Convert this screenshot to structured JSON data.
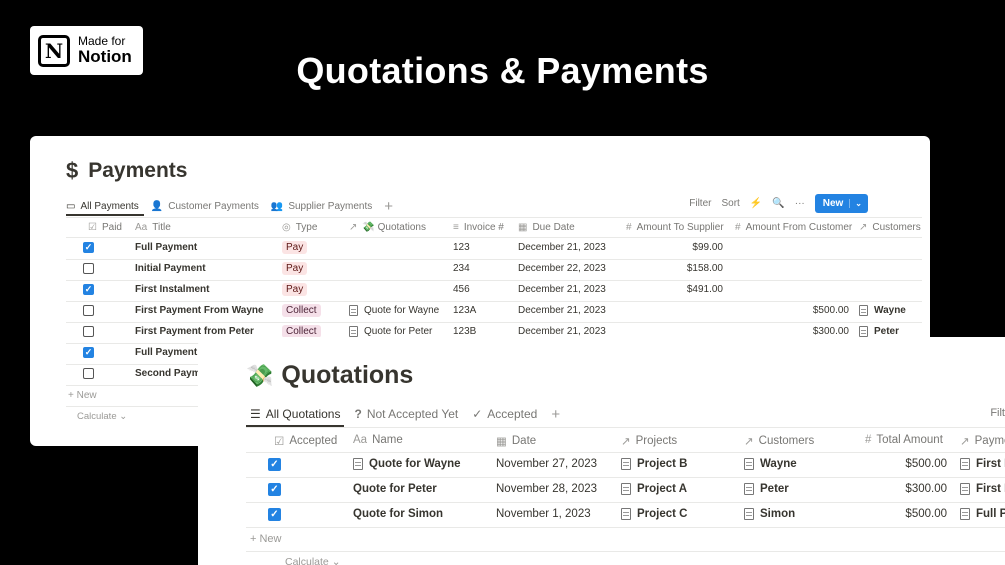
{
  "badge": {
    "line1": "Made for",
    "line2": "Notion",
    "logo": "N"
  },
  "hero_title": "Quotations & Payments",
  "payments": {
    "title_icon": "$",
    "title": "Payments",
    "tabs": [
      {
        "icon": "table-icon",
        "glyph": "▭",
        "label": "All Payments"
      },
      {
        "icon": "person-icon",
        "glyph": "👤",
        "label": "Customer Payments"
      },
      {
        "icon": "people-icon",
        "glyph": "👥",
        "label": "Supplier Payments"
      }
    ],
    "add_tab": "+",
    "toolbar": {
      "filter": "Filter",
      "sort": "Sort",
      "lightning": "⚡",
      "search": "🔍",
      "more": "···",
      "new": "New",
      "new_chevron": "⌄"
    },
    "headers": [
      {
        "icon": "☑",
        "label": "Paid"
      },
      {
        "icon": "Aa",
        "label": "Title"
      },
      {
        "icon": "◎",
        "label": "Type"
      },
      {
        "icon": "↗",
        "label": "💸 Quotations"
      },
      {
        "icon": "≡",
        "label": "Invoice #"
      },
      {
        "icon": "▦",
        "label": "Due Date"
      },
      {
        "icon": "#",
        "label": "Amount To Supplier"
      },
      {
        "icon": "#",
        "label": "Amount From Customer"
      },
      {
        "icon": "↗",
        "label": "Customers"
      }
    ],
    "rows": [
      {
        "paid": true,
        "title": "Full Payment",
        "type": "Pay",
        "quotation": "",
        "invoice": "123",
        "due": "December 21, 2023",
        "to_supplier": "$99.00",
        "from_customer": "",
        "customer": ""
      },
      {
        "paid": false,
        "title": "Initial Payment",
        "type": "Pay",
        "quotation": "",
        "invoice": "234",
        "due": "December 22, 2023",
        "to_supplier": "$158.00",
        "from_customer": "",
        "customer": ""
      },
      {
        "paid": true,
        "title": "First Instalment",
        "type": "Pay",
        "quotation": "",
        "invoice": "456",
        "due": "December 21, 2023",
        "to_supplier": "$491.00",
        "from_customer": "",
        "customer": ""
      },
      {
        "paid": false,
        "title": "First Payment From Wayne",
        "type": "Collect",
        "quotation": "Quote for Wayne",
        "invoice": "123A",
        "due": "December 21, 2023",
        "to_supplier": "",
        "from_customer": "$500.00",
        "customer": "Wayne"
      },
      {
        "paid": false,
        "title": "First Payment from Peter",
        "type": "Collect",
        "quotation": "Quote for Peter",
        "invoice": "123B",
        "due": "December 21, 2023",
        "to_supplier": "",
        "from_customer": "$300.00",
        "customer": "Peter"
      },
      {
        "paid": true,
        "title": "Full Payment f",
        "type": "",
        "quotation": "",
        "invoice": "",
        "due": "",
        "to_supplier": "",
        "from_customer": "",
        "customer": ""
      },
      {
        "paid": false,
        "title": "Second Payme",
        "type": "",
        "quotation": "",
        "invoice": "",
        "due": "",
        "to_supplier": "",
        "from_customer": "",
        "customer": ""
      }
    ],
    "new_row": "+ New",
    "calculate": "Calculate ⌄"
  },
  "quotations": {
    "title_icon": "💸",
    "title": "Quotations",
    "tabs": [
      {
        "icon": "list-icon",
        "glyph": "☰",
        "label": "All Quotations"
      },
      {
        "icon": "question-icon",
        "glyph": "?",
        "label": "Not Accepted Yet"
      },
      {
        "icon": "check-icon",
        "glyph": "✓",
        "label": "Accepted"
      }
    ],
    "add_tab": "+",
    "filter": "Filt",
    "headers": [
      {
        "icon": "☑",
        "label": "Accepted"
      },
      {
        "icon": "Aa",
        "label": "Name"
      },
      {
        "icon": "▦",
        "label": "Date"
      },
      {
        "icon": "↗",
        "label": "Projects"
      },
      {
        "icon": "↗",
        "label": "Customers"
      },
      {
        "icon": "#",
        "label": "Total Amount"
      },
      {
        "icon": "↗",
        "label": "Payme"
      }
    ],
    "rows": [
      {
        "accepted": true,
        "name": "Quote for Wayne",
        "date": "November 27, 2023",
        "project": "Project B",
        "customer": "Wayne",
        "total": "$500.00",
        "payment": "First P"
      },
      {
        "accepted": true,
        "name": "Quote for Peter",
        "date": "November 28, 2023",
        "project": "Project A",
        "customer": "Peter",
        "total": "$300.00",
        "payment": "First P"
      },
      {
        "accepted": true,
        "name": "Quote for Simon",
        "date": "November 1, 2023",
        "project": "Project C",
        "customer": "Simon",
        "total": "$500.00",
        "payment": "Full Pa"
      }
    ],
    "new_row": "+ New",
    "calculate": "Calculate ⌄"
  },
  "colors": {
    "accent": "#2383e2",
    "pay_tag": "#fbe4e4",
    "collect_tag": "#f5e0e9",
    "background": "#000000"
  }
}
